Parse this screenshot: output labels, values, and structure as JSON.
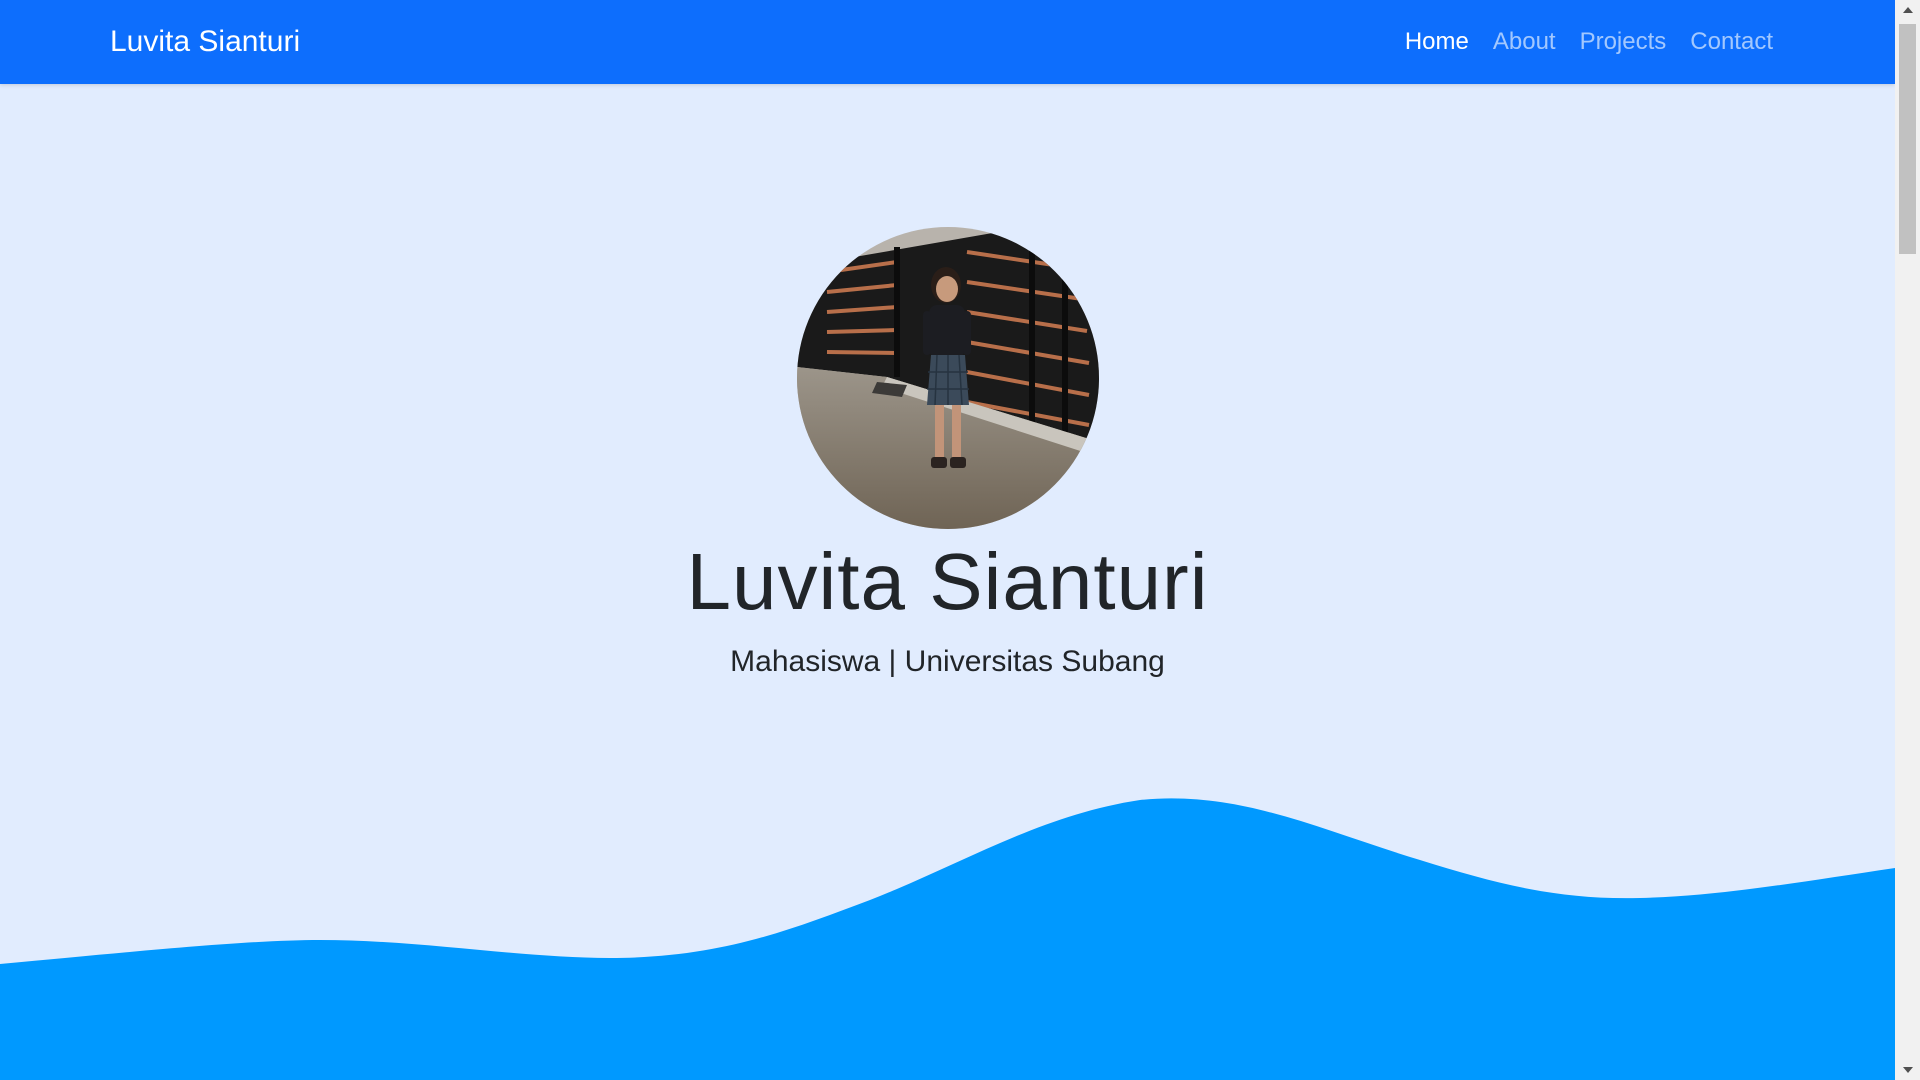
{
  "navbar": {
    "brand": "Luvita Sianturi",
    "links": [
      {
        "label": "Home",
        "active": true
      },
      {
        "label": "About",
        "active": false
      },
      {
        "label": "Projects",
        "active": false
      },
      {
        "label": "Contact",
        "active": false
      }
    ]
  },
  "hero": {
    "name": "Luvita Sianturi",
    "subtitle": "Mahasiswa | Universitas Subang",
    "photo_alt": "profile photo of a woman standing in front of a dark striped gate"
  },
  "colors": {
    "navbar_bg": "#0d6efd",
    "page_bg": "#e1ecfe",
    "wave": "#0099ff",
    "text": "#212529"
  },
  "scrollbar": {
    "up_icon": "scroll-up-arrow-icon",
    "down_icon": "scroll-down-arrow-icon"
  }
}
